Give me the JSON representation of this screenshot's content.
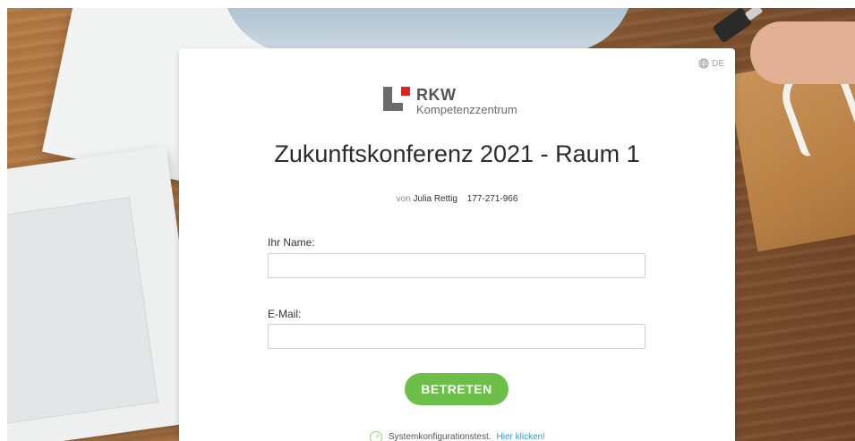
{
  "language": {
    "code": "DE",
    "icon": "globe-icon"
  },
  "logo": {
    "brand": "RKW",
    "subtitle": "Kompetenzzentrum"
  },
  "meeting": {
    "title": "Zukunftskonferenz 2021 - Raum 1",
    "by_prefix": "von",
    "host": "Julia Rettig",
    "meeting_id": "177-271-966"
  },
  "form": {
    "name_label": "Ihr Name:",
    "name_value": "",
    "email_label": "E-Mail:",
    "email_value": "",
    "submit_label": "BETRETEN"
  },
  "system_test": {
    "icon": "speedometer-icon",
    "text": "Systemkonfigurationstest.",
    "link": "Hier klicken!"
  },
  "colors": {
    "accent_green": "#6cc04a",
    "link_blue": "#2e9bd6",
    "logo_red": "#e2231a",
    "logo_gray": "#6b6b6b"
  }
}
